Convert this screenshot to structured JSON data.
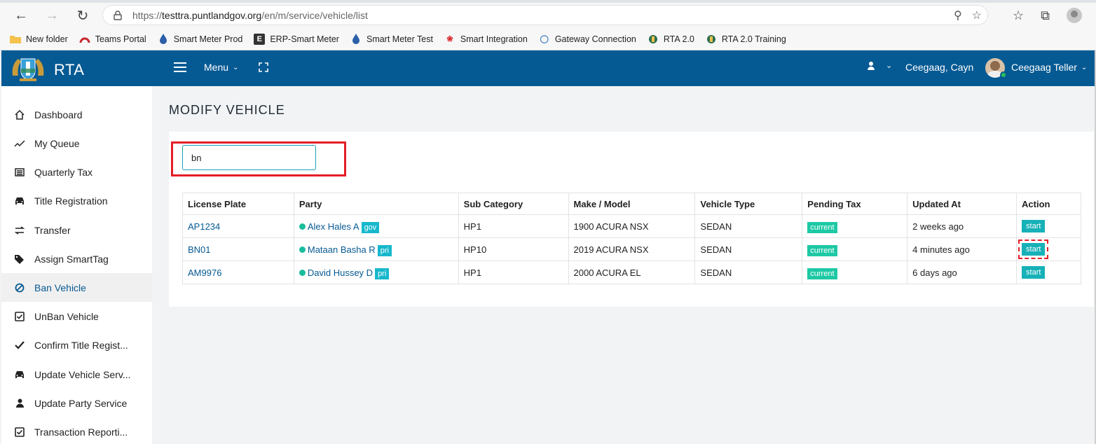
{
  "browser": {
    "url_prefix": "https://",
    "url_host": "testtra.puntlandgov.org",
    "url_path": "/en/m/service/vehicle/list",
    "bookmarks": [
      {
        "label": "New folder",
        "icon": "folder-icon"
      },
      {
        "label": "Teams Portal",
        "icon": "gauge-icon"
      },
      {
        "label": "Smart Meter Prod",
        "icon": "drop-icon"
      },
      {
        "label": "ERP-Smart Meter",
        "icon": "e-icon"
      },
      {
        "label": "Smart Meter Test",
        "icon": "drop-icon"
      },
      {
        "label": "Smart Integration",
        "icon": "huawei-icon"
      },
      {
        "label": "Gateway Connection",
        "icon": "globe-icon"
      },
      {
        "label": "RTA 2.0",
        "icon": "emblem-icon"
      },
      {
        "label": "RTA 2.0 Training",
        "icon": "emblem-icon"
      }
    ]
  },
  "header": {
    "app_title": "RTA",
    "menu_label": "Menu",
    "user_label": "Ceegaag, Cayn",
    "teller_label": "Ceegaag Teller",
    "brand_color": "#065a93"
  },
  "sidebar": {
    "items": [
      {
        "label": "Dashboard",
        "icon": "home-icon"
      },
      {
        "label": "My Queue",
        "icon": "trend-icon"
      },
      {
        "label": "Quarterly Tax",
        "icon": "list-icon"
      },
      {
        "label": "Title Registration",
        "icon": "car-icon"
      },
      {
        "label": "Transfer",
        "icon": "exchange-icon"
      },
      {
        "label": "Assign SmartTag",
        "icon": "tags-icon"
      },
      {
        "label": "Ban Vehicle",
        "icon": "ban-icon",
        "active": true
      },
      {
        "label": "UnBan Vehicle",
        "icon": "checkbox-icon"
      },
      {
        "label": "Confirm Title Regist...",
        "icon": "check-icon"
      },
      {
        "label": "Update Vehicle Serv...",
        "icon": "car-icon"
      },
      {
        "label": "Update Party Service",
        "icon": "user-icon"
      },
      {
        "label": "Transaction Reporti...",
        "icon": "checkbox-icon"
      }
    ]
  },
  "main": {
    "page_title": "MODIFY VEHICLE",
    "search_value": "bn",
    "table": {
      "headers": [
        "License Plate",
        "Party",
        "Sub Category",
        "Make / Model",
        "Vehicle Type",
        "Pending Tax",
        "Updated At",
        "Action"
      ],
      "rows": [
        {
          "plate": "AP1234",
          "party": "Alex Hales A",
          "party_tag": "gov",
          "sub_category": "HP1",
          "make_model": "1900 ACURA NSX",
          "vehicle_type": "SEDAN",
          "pending_tax": "current",
          "updated_at": "2 weeks ago",
          "action": "start"
        },
        {
          "plate": "BN01",
          "party": "Mataan Basha R",
          "party_tag": "pri",
          "sub_category": "HP10",
          "make_model": "2019 ACURA NSX",
          "vehicle_type": "SEDAN",
          "pending_tax": "current",
          "updated_at": "4 minutes ago",
          "action": "start"
        },
        {
          "plate": "AM9976",
          "party": "David Hussey D",
          "party_tag": "pri",
          "sub_category": "HP1",
          "make_model": "2000 ACURA EL",
          "vehicle_type": "SEDAN",
          "pending_tax": "current",
          "updated_at": "6 days ago",
          "action": "start"
        }
      ]
    }
  }
}
